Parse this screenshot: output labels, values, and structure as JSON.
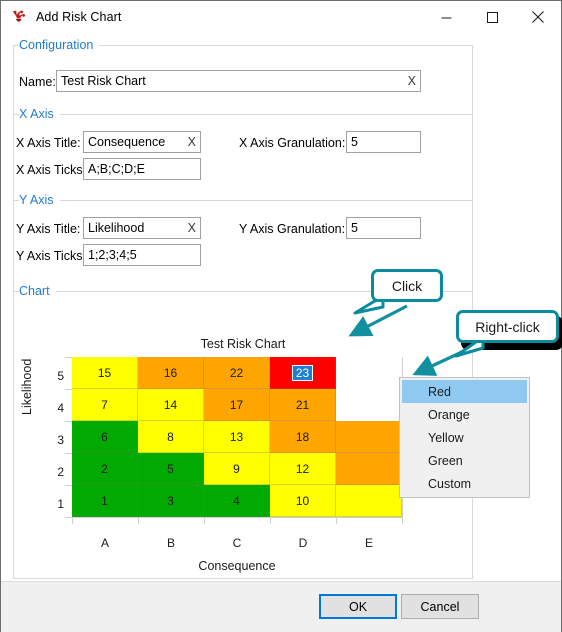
{
  "window": {
    "title": "Add Risk Chart",
    "icon": "risk-chart-app-icon",
    "minimize_label": "─",
    "maximize_label": "□",
    "close_label": "✕"
  },
  "sections": {
    "configuration": "Configuration",
    "x_axis": "X Axis",
    "y_axis": "Y Axis",
    "chart": "Chart"
  },
  "fields": {
    "name_label": "Name:",
    "name_value": "Test Risk Chart",
    "name_clear": "X",
    "x_axis_title_label": "X Axis Title:",
    "x_axis_title_value": "Consequence",
    "x_axis_title_clear": "X",
    "x_axis_granulation_label": "X Axis Granulation:",
    "x_axis_granulation_value": "5",
    "x_axis_ticks_label": "X Axis Ticks:",
    "x_axis_ticks_value": "A;B;C;D;E",
    "y_axis_title_label": "Y Axis Title:",
    "y_axis_title_value": "Likelihood",
    "y_axis_title_clear": "X",
    "y_axis_granulation_label": "Y Axis Granulation:",
    "y_axis_granulation_value": "5",
    "y_axis_ticks_label": "Y Axis Ticks:",
    "y_axis_ticks_value": "1;2;3;4;5"
  },
  "chart_data": {
    "type": "heatmap",
    "title": "Test Risk Chart",
    "xlabel": "Consequence",
    "ylabel": "Likelihood",
    "categories": [
      "A",
      "B",
      "C",
      "D",
      "E"
    ],
    "rows": [
      "5",
      "4",
      "3",
      "2",
      "1"
    ],
    "grid": true,
    "legend": "none",
    "colors": {
      "red": "#FF0000",
      "orange": "#FFA500",
      "yellow": "#FFFF00",
      "green": "#00AA00",
      "selection": "#1D7FD4"
    },
    "selected_cell": {
      "row": "5",
      "column": "D",
      "value": "23"
    },
    "cells": [
      {
        "row": "5",
        "col": "A",
        "value": "15",
        "color": "#FFFF00"
      },
      {
        "row": "5",
        "col": "B",
        "value": "16",
        "color": "#FFA500"
      },
      {
        "row": "5",
        "col": "C",
        "value": "22",
        "color": "#FFA500"
      },
      {
        "row": "5",
        "col": "D",
        "value": "23",
        "color": "#FF0000"
      },
      {
        "row": "5",
        "col": "E",
        "value": "",
        "color": "#FFFFFF"
      },
      {
        "row": "4",
        "col": "A",
        "value": "7",
        "color": "#FFFF00"
      },
      {
        "row": "4",
        "col": "B",
        "value": "14",
        "color": "#FFFF00"
      },
      {
        "row": "4",
        "col": "C",
        "value": "17",
        "color": "#FFA500"
      },
      {
        "row": "4",
        "col": "D",
        "value": "21",
        "color": "#FFA500"
      },
      {
        "row": "4",
        "col": "E",
        "value": "",
        "color": "#FFFFFF"
      },
      {
        "row": "3",
        "col": "A",
        "value": "6",
        "color": "#00AA00"
      },
      {
        "row": "3",
        "col": "B",
        "value": "8",
        "color": "#FFFF00"
      },
      {
        "row": "3",
        "col": "C",
        "value": "13",
        "color": "#FFFF00"
      },
      {
        "row": "3",
        "col": "D",
        "value": "18",
        "color": "#FFA500"
      },
      {
        "row": "3",
        "col": "E",
        "value": "",
        "color": "#FFA500"
      },
      {
        "row": "2",
        "col": "A",
        "value": "2",
        "color": "#00AA00"
      },
      {
        "row": "2",
        "col": "B",
        "value": "5",
        "color": "#00AA00"
      },
      {
        "row": "2",
        "col": "C",
        "value": "9",
        "color": "#FFFF00"
      },
      {
        "row": "2",
        "col": "D",
        "value": "12",
        "color": "#FFFF00"
      },
      {
        "row": "2",
        "col": "E",
        "value": "",
        "color": "#FFA500"
      },
      {
        "row": "1",
        "col": "A",
        "value": "1",
        "color": "#00AA00"
      },
      {
        "row": "1",
        "col": "B",
        "value": "3",
        "color": "#00AA00"
      },
      {
        "row": "1",
        "col": "C",
        "value": "4",
        "color": "#00AA00"
      },
      {
        "row": "1",
        "col": "D",
        "value": "10",
        "color": "#FFFF00"
      },
      {
        "row": "1",
        "col": "E",
        "value": "",
        "color": "#FFFF00"
      }
    ]
  },
  "context_menu": {
    "items": [
      {
        "label": "Red",
        "highlighted": true
      },
      {
        "label": "Orange",
        "highlighted": false
      },
      {
        "label": "Yellow",
        "highlighted": false
      },
      {
        "label": "Green",
        "highlighted": false
      },
      {
        "label": "Custom",
        "highlighted": false
      }
    ]
  },
  "callouts": {
    "click": "Click",
    "right_click": "Right-click",
    "accent": "#0B8C9E"
  },
  "footer": {
    "ok": "OK",
    "cancel": "Cancel"
  }
}
